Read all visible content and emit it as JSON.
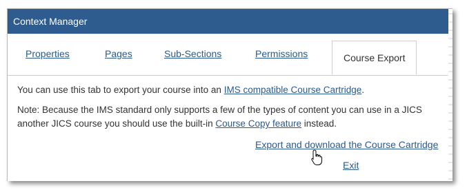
{
  "header": {
    "title": "Context Manager"
  },
  "tabs": [
    {
      "label": "Properties"
    },
    {
      "label": "Pages"
    },
    {
      "label": "Sub-Sections"
    },
    {
      "label": "Permissions"
    },
    {
      "label": "Course Export"
    }
  ],
  "content": {
    "intro_before": "You can use this tab to export your course into an ",
    "intro_link": "IMS compatible Course Cartridge",
    "intro_after": ".",
    "note_line1": "Note: Because the IMS standard only supports a few of the types of content you can use in a JICS",
    "note_line2_before": "another JICS course you should use the built-in ",
    "note_link": "Course Copy feature",
    "note_line2_after": " instead."
  },
  "actions": {
    "export_label": "Export and download the Course Cartridge",
    "exit_label": "Exit"
  }
}
